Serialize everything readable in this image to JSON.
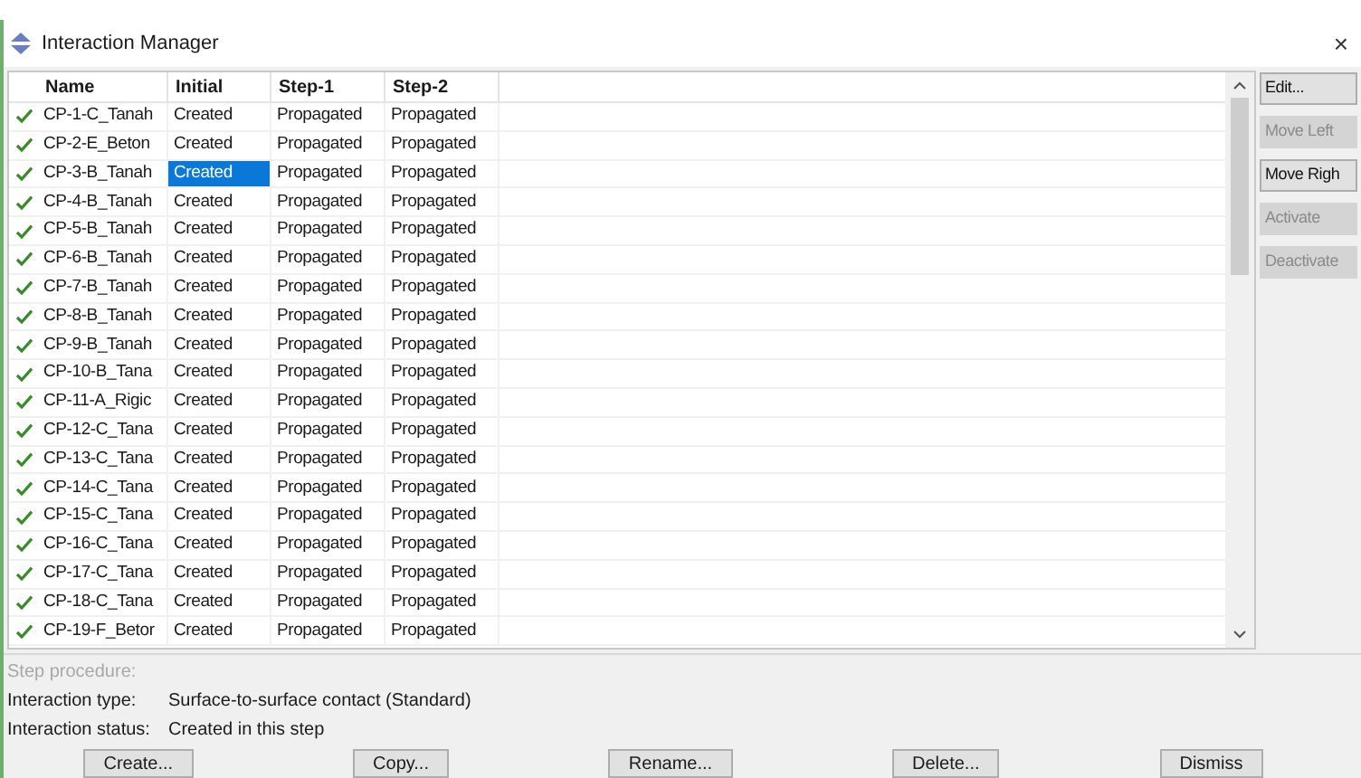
{
  "window": {
    "title": "Interaction Manager",
    "close": "×"
  },
  "table": {
    "columns": [
      "Name",
      "Initial",
      "Step-1",
      "Step-2"
    ],
    "rows": [
      {
        "active": true,
        "cells": [
          {
            "text": "CP-1-C_Tanah",
            "selected": false
          },
          {
            "text": "Created",
            "selected": false
          },
          {
            "text": "Propagated",
            "selected": false
          },
          {
            "text": "Propagated",
            "selected": false
          }
        ]
      },
      {
        "active": true,
        "cells": [
          {
            "text": "CP-2-E_Beton",
            "selected": false
          },
          {
            "text": "Created",
            "selected": false
          },
          {
            "text": "Propagated",
            "selected": false
          },
          {
            "text": "Propagated",
            "selected": false
          }
        ]
      },
      {
        "active": true,
        "cells": [
          {
            "text": "CP-3-B_Tanah",
            "selected": false
          },
          {
            "text": "Created",
            "selected": true
          },
          {
            "text": "Propagated",
            "selected": false
          },
          {
            "text": "Propagated",
            "selected": false
          }
        ]
      },
      {
        "active": true,
        "cells": [
          {
            "text": "CP-4-B_Tanah",
            "selected": false
          },
          {
            "text": "Created",
            "selected": false
          },
          {
            "text": "Propagated",
            "selected": false
          },
          {
            "text": "Propagated",
            "selected": false
          }
        ]
      },
      {
        "active": true,
        "cells": [
          {
            "text": "CP-5-B_Tanah",
            "selected": false
          },
          {
            "text": "Created",
            "selected": false
          },
          {
            "text": "Propagated",
            "selected": false
          },
          {
            "text": "Propagated",
            "selected": false
          }
        ]
      },
      {
        "active": true,
        "cells": [
          {
            "text": "CP-6-B_Tanah",
            "selected": false
          },
          {
            "text": "Created",
            "selected": false
          },
          {
            "text": "Propagated",
            "selected": false
          },
          {
            "text": "Propagated",
            "selected": false
          }
        ]
      },
      {
        "active": true,
        "cells": [
          {
            "text": "CP-7-B_Tanah",
            "selected": false
          },
          {
            "text": "Created",
            "selected": false
          },
          {
            "text": "Propagated",
            "selected": false
          },
          {
            "text": "Propagated",
            "selected": false
          }
        ]
      },
      {
        "active": true,
        "cells": [
          {
            "text": "CP-8-B_Tanah",
            "selected": false
          },
          {
            "text": "Created",
            "selected": false
          },
          {
            "text": "Propagated",
            "selected": false
          },
          {
            "text": "Propagated",
            "selected": false
          }
        ]
      },
      {
        "active": true,
        "cells": [
          {
            "text": "CP-9-B_Tanah",
            "selected": false
          },
          {
            "text": "Created",
            "selected": false
          },
          {
            "text": "Propagated",
            "selected": false
          },
          {
            "text": "Propagated",
            "selected": false
          }
        ]
      },
      {
        "active": true,
        "cells": [
          {
            "text": "CP-10-B_Tana",
            "selected": false
          },
          {
            "text": "Created",
            "selected": false
          },
          {
            "text": "Propagated",
            "selected": false
          },
          {
            "text": "Propagated",
            "selected": false
          }
        ]
      },
      {
        "active": true,
        "cells": [
          {
            "text": "CP-11-A_Rigic",
            "selected": false
          },
          {
            "text": "Created",
            "selected": false
          },
          {
            "text": "Propagated",
            "selected": false
          },
          {
            "text": "Propagated",
            "selected": false
          }
        ]
      },
      {
        "active": true,
        "cells": [
          {
            "text": "CP-12-C_Tana",
            "selected": false
          },
          {
            "text": "Created",
            "selected": false
          },
          {
            "text": "Propagated",
            "selected": false
          },
          {
            "text": "Propagated",
            "selected": false
          }
        ]
      },
      {
        "active": true,
        "cells": [
          {
            "text": "CP-13-C_Tana",
            "selected": false
          },
          {
            "text": "Created",
            "selected": false
          },
          {
            "text": "Propagated",
            "selected": false
          },
          {
            "text": "Propagated",
            "selected": false
          }
        ]
      },
      {
        "active": true,
        "cells": [
          {
            "text": "CP-14-C_Tana",
            "selected": false
          },
          {
            "text": "Created",
            "selected": false
          },
          {
            "text": "Propagated",
            "selected": false
          },
          {
            "text": "Propagated",
            "selected": false
          }
        ]
      },
      {
        "active": true,
        "cells": [
          {
            "text": "CP-15-C_Tana",
            "selected": false
          },
          {
            "text": "Created",
            "selected": false
          },
          {
            "text": "Propagated",
            "selected": false
          },
          {
            "text": "Propagated",
            "selected": false
          }
        ]
      },
      {
        "active": true,
        "cells": [
          {
            "text": "CP-16-C_Tana",
            "selected": false
          },
          {
            "text": "Created",
            "selected": false
          },
          {
            "text": "Propagated",
            "selected": false
          },
          {
            "text": "Propagated",
            "selected": false
          }
        ]
      },
      {
        "active": true,
        "cells": [
          {
            "text": "CP-17-C_Tana",
            "selected": false
          },
          {
            "text": "Created",
            "selected": false
          },
          {
            "text": "Propagated",
            "selected": false
          },
          {
            "text": "Propagated",
            "selected": false
          }
        ]
      },
      {
        "active": true,
        "cells": [
          {
            "text": "CP-18-C_Tana",
            "selected": false
          },
          {
            "text": "Created",
            "selected": false
          },
          {
            "text": "Propagated",
            "selected": false
          },
          {
            "text": "Propagated",
            "selected": false
          }
        ]
      },
      {
        "active": true,
        "cells": [
          {
            "text": "CP-19-F_Betor",
            "selected": false
          },
          {
            "text": "Created",
            "selected": false
          },
          {
            "text": "Propagated",
            "selected": false
          },
          {
            "text": "Propagated",
            "selected": false
          }
        ]
      }
    ]
  },
  "side_buttons": [
    {
      "label": "Edit...",
      "disabled": false
    },
    {
      "label": "Move Left",
      "disabled": true
    },
    {
      "label": "Move Righ",
      "disabled": false
    },
    {
      "label": "Activate",
      "disabled": true
    },
    {
      "label": "Deactivate",
      "disabled": true
    }
  ],
  "details": [
    {
      "label": "Step procedure:",
      "disabled": true
    },
    {
      "label": "Interaction type:",
      "value": "Surface-to-surface contact (Standard)",
      "disabled": false
    },
    {
      "label": "Interaction status:",
      "value": "Created in this step",
      "disabled": false
    }
  ],
  "buttons": [
    "Create...",
    "Copy...",
    "Rename...",
    "Delete...",
    "Dismiss"
  ]
}
